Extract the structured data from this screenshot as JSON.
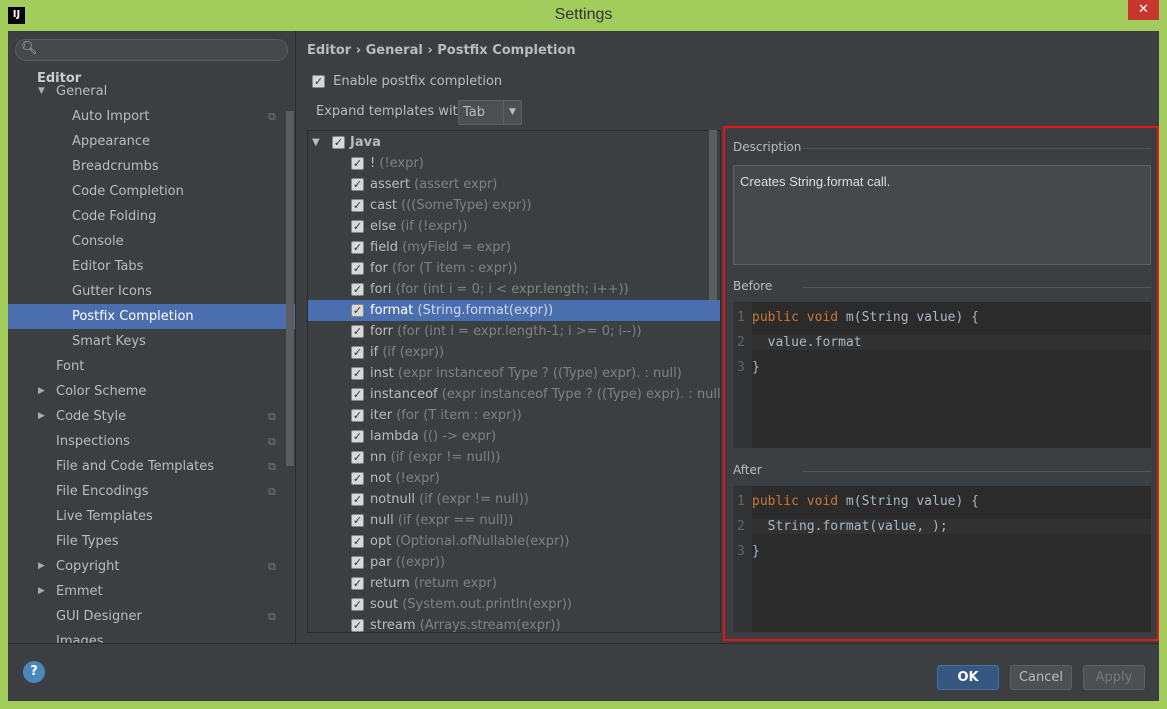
{
  "window": {
    "title": "Settings",
    "logo": "IJ",
    "close": "✕"
  },
  "sidebar": {
    "search_placeholder": "",
    "section": "Editor",
    "items": [
      {
        "label": "General",
        "level": 1,
        "expanded": true
      },
      {
        "label": "Auto Import",
        "level": 2,
        "copy": true
      },
      {
        "label": "Appearance",
        "level": 2
      },
      {
        "label": "Breadcrumbs",
        "level": 2
      },
      {
        "label": "Code Completion",
        "level": 2
      },
      {
        "label": "Code Folding",
        "level": 2
      },
      {
        "label": "Console",
        "level": 2
      },
      {
        "label": "Editor Tabs",
        "level": 2
      },
      {
        "label": "Gutter Icons",
        "level": 2
      },
      {
        "label": "Postfix Completion",
        "level": 2,
        "selected": true
      },
      {
        "label": "Smart Keys",
        "level": 2
      },
      {
        "label": "Font",
        "level": 1
      },
      {
        "label": "Color Scheme",
        "level": 1,
        "collapsed": true
      },
      {
        "label": "Code Style",
        "level": 1,
        "collapsed": true,
        "copy": true
      },
      {
        "label": "Inspections",
        "level": 1,
        "copy": true
      },
      {
        "label": "File and Code Templates",
        "level": 1,
        "copy": true
      },
      {
        "label": "File Encodings",
        "level": 1,
        "copy": true
      },
      {
        "label": "Live Templates",
        "level": 1
      },
      {
        "label": "File Types",
        "level": 1
      },
      {
        "label": "Copyright",
        "level": 1,
        "collapsed": true,
        "copy": true
      },
      {
        "label": "Emmet",
        "level": 1,
        "collapsed": true
      },
      {
        "label": "GUI Designer",
        "level": 1,
        "copy": true
      },
      {
        "label": "Images",
        "level": 1
      }
    ]
  },
  "breadcrumb": [
    "Editor",
    "General",
    "Postfix Completion"
  ],
  "enable_label": "Enable postfix completion",
  "enable_checked": true,
  "expand_label": "Expand templates with",
  "expand_value": "Tab",
  "templates": {
    "group": "Java",
    "items": [
      {
        "key": "!",
        "hint": "(!expr)"
      },
      {
        "key": "assert",
        "hint": "(assert expr)"
      },
      {
        "key": "cast",
        "hint": "(((SomeType) expr))"
      },
      {
        "key": "else",
        "hint": "(if (!expr))"
      },
      {
        "key": "field",
        "hint": "(myField = expr)"
      },
      {
        "key": "for",
        "hint": "(for (T item : expr))"
      },
      {
        "key": "fori",
        "hint": "(for (int i = 0; i < expr.length; i++))"
      },
      {
        "key": "format",
        "hint": "(String.format(expr))",
        "selected": true
      },
      {
        "key": "forr",
        "hint": "(for (int i = expr.length-1; i >= 0; i--))"
      },
      {
        "key": "if",
        "hint": "(if (expr))"
      },
      {
        "key": "inst",
        "hint": "(expr instanceof Type ? ((Type) expr). : null)"
      },
      {
        "key": "instanceof",
        "hint": "(expr instanceof Type ? ((Type) expr). : null)"
      },
      {
        "key": "iter",
        "hint": "(for (T item : expr))"
      },
      {
        "key": "lambda",
        "hint": "(() -> expr)"
      },
      {
        "key": "nn",
        "hint": "(if (expr != null))"
      },
      {
        "key": "not",
        "hint": "(!expr)"
      },
      {
        "key": "notnull",
        "hint": "(if (expr != null))"
      },
      {
        "key": "null",
        "hint": "(if (expr == null))"
      },
      {
        "key": "opt",
        "hint": "(Optional.ofNullable(expr))"
      },
      {
        "key": "par",
        "hint": "((expr))"
      },
      {
        "key": "return",
        "hint": "(return expr)"
      },
      {
        "key": "sout",
        "hint": "(System.out.println(expr))"
      },
      {
        "key": "stream",
        "hint": "(Arrays.stream(expr))"
      }
    ]
  },
  "detail": {
    "description_label": "Description",
    "description": "Creates String.format call.",
    "before_label": "Before",
    "before": [
      "public void m(String value) {",
      "  value.format",
      "}"
    ],
    "after_label": "After",
    "after": [
      "public void m(String value) {",
      "  String.format(value, );",
      "}"
    ]
  },
  "buttons": {
    "ok": "OK",
    "cancel": "Cancel",
    "apply": "Apply",
    "help": "?"
  },
  "colors": {
    "accent": "#4b6eaf",
    "highlight_border": "#e8141b",
    "title_bar": "#a2cd5d"
  }
}
